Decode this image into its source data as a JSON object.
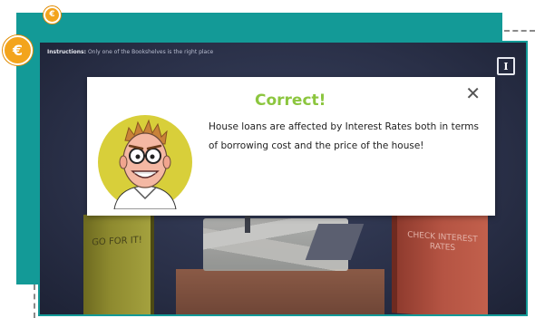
{
  "coins": {
    "small": "€",
    "large": "€"
  },
  "header": {
    "instructions_label": "Instructions:",
    "instructions_text": "Only one of the Bookshelves is the right place",
    "info_icon": "I"
  },
  "scene": {
    "book_left": "GO FOR IT!",
    "book_right": "CHECK INTEREST RATES"
  },
  "modal": {
    "title": "Correct!",
    "message": "House loans are affected by Interest Rates both in terms of borrowing cost and the price of the house!",
    "close_icon": "close-icon",
    "title_color": "#8cc63f"
  },
  "colors": {
    "teal": "#139a97",
    "coin": "#f3a41c",
    "background": "#2a3048"
  }
}
